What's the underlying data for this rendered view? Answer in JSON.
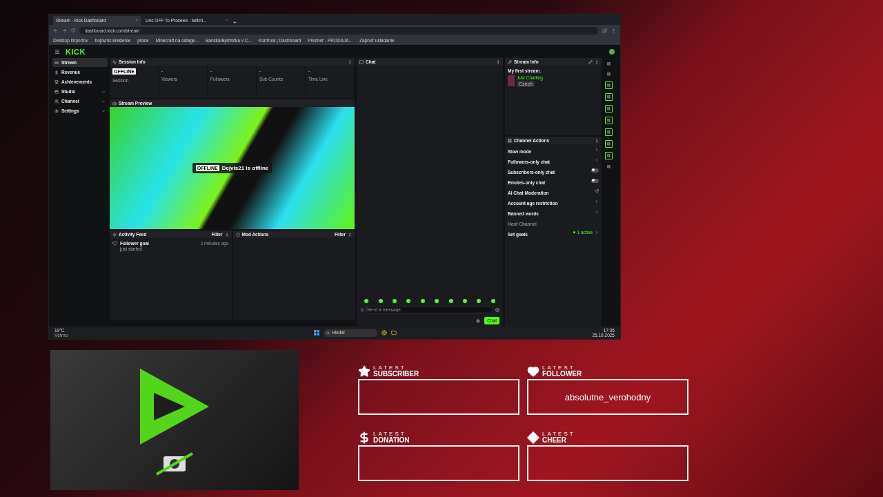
{
  "browser": {
    "tabs": [
      {
        "title": "Stream - Kick Dashboard",
        "selected": true
      },
      {
        "title": "Unc OFF To Proceed - twitch...",
        "selected": false
      }
    ],
    "url": "dashboard.kick.com/stream",
    "bookmarks": [
      "Desktop importov",
      "bojovnic kreslenie",
      "práce",
      "Minecraft na odlage...",
      "Banská/Bystrička v C...",
      "Kontrola | Dashboard",
      "Prezrieť - PRODAJA...",
      "Zapnúť ukladanie"
    ]
  },
  "app": {
    "logo": "KICK",
    "sidebar": [
      {
        "label": "Stream",
        "selected": true,
        "expandable": false
      },
      {
        "label": "Revenue",
        "selected": false,
        "expandable": false
      },
      {
        "label": "Achievements",
        "selected": false,
        "expandable": false
      },
      {
        "label": "Studio",
        "selected": false,
        "expandable": true
      },
      {
        "label": "Channel",
        "selected": false,
        "expandable": true
      },
      {
        "label": "Settings",
        "selected": false,
        "expandable": true
      }
    ],
    "session_info": {
      "title": "Session Info",
      "stats": [
        {
          "badge": "OFFLINE",
          "label": "Session"
        },
        {
          "value": "-",
          "label": "Viewers"
        },
        {
          "value": "-",
          "label": "Followers"
        },
        {
          "value": "-",
          "label": "Sub Counts"
        },
        {
          "value": "-",
          "label": "Time Live"
        }
      ]
    },
    "stream_preview": {
      "title": "Stream Preview",
      "status": "OFFLINE",
      "message": "Dejvis21 is offline"
    },
    "activity_feed": {
      "title": "Activity Feed",
      "filter": "Filter",
      "items": [
        {
          "title": "Follower goal",
          "subtitle": "just started",
          "time": "2 minutes ago"
        }
      ]
    },
    "mod_actions": {
      "title": "Mod Actions",
      "filter": "Filter"
    },
    "chat": {
      "title": "Chat",
      "placeholder": "Send a message",
      "send": "Chat"
    },
    "stream_info": {
      "title": "Stream Info",
      "stream_title": "My first stream.",
      "category": "Just Chatting",
      "tag": "Czech"
    },
    "channel_actions": {
      "title": "Channel Actions",
      "items": [
        {
          "label": "Slow mode",
          "kind": "link"
        },
        {
          "label": "Followers-only chat",
          "kind": "link"
        },
        {
          "label": "Subscribers-only chat",
          "kind": "toggle",
          "on": false
        },
        {
          "label": "Emotes-only chat",
          "kind": "toggle",
          "on": false
        },
        {
          "label": "AI Chat Moderation",
          "kind": "external"
        },
        {
          "label": "Account age restriction",
          "kind": "link"
        },
        {
          "label": "Banned words",
          "kind": "link"
        },
        {
          "label": "Host Channel",
          "kind": "disabled"
        },
        {
          "label": "Set goals",
          "kind": "goal",
          "status": "1 active"
        }
      ]
    }
  },
  "taskbar": {
    "temperature": "19°C",
    "weather": "Větrno",
    "search_placeholder": "Hledat",
    "time": "17:05",
    "date": "25.10.2025"
  },
  "overlay": {
    "alerts": [
      {
        "kind": "subscriber",
        "prefix": "LATEST",
        "label": "SUBSCRIBER"
      },
      {
        "kind": "follower",
        "prefix": "LATEST",
        "label": "FOLLOWER",
        "value": "absolutne_verohodny"
      },
      {
        "kind": "donation",
        "prefix": "LATEST",
        "label": "DONATION"
      },
      {
        "kind": "cheer",
        "prefix": "LATEST",
        "label": "CHEER"
      }
    ]
  }
}
